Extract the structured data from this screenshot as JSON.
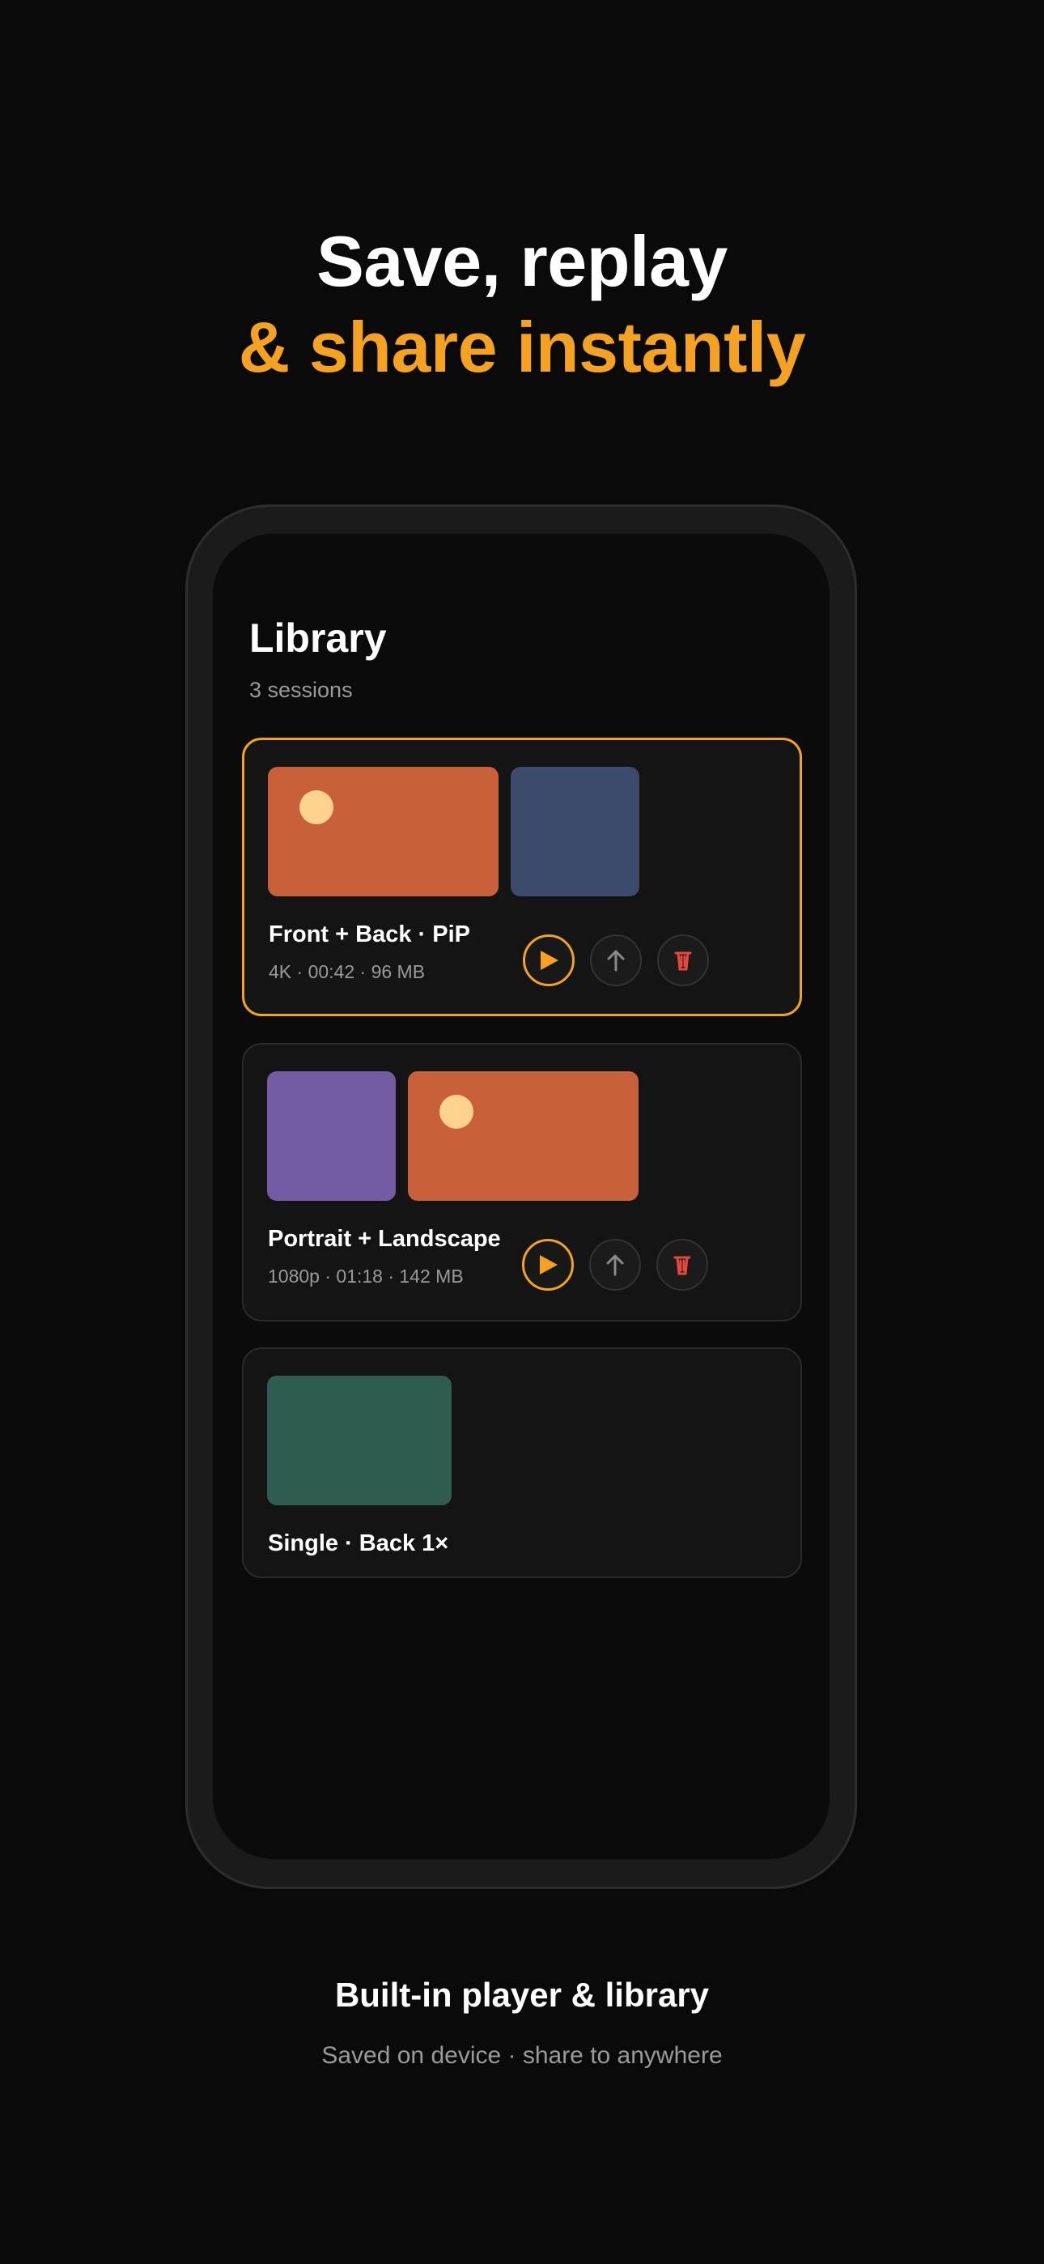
{
  "headline": {
    "line1": "Save, replay",
    "line2": "& share instantly"
  },
  "library": {
    "title": "Library",
    "subtitle": "3 sessions",
    "sessions": [
      {
        "title": "Front + Back · PiP",
        "meta": "4K · 00:42 · 96 MB",
        "selected": true,
        "thumbnails": [
          "#c8603a",
          "#3c4a6c"
        ],
        "actions": [
          "play-icon",
          "share-icon",
          "delete-icon"
        ]
      },
      {
        "title": "Portrait + Landscape",
        "meta": "1080p · 01:18 · 142 MB",
        "selected": false,
        "thumbnails": [
          "#735ca3",
          "#c8603a"
        ],
        "actions": [
          "play-icon",
          "share-icon",
          "delete-icon"
        ]
      },
      {
        "title": "Single · Back 1×",
        "selected": false,
        "thumbnails": [
          "#2f5c51"
        ]
      }
    ]
  },
  "footer": {
    "title": "Built-in player & library",
    "subtitle": "Saved on device · share to anywhere"
  },
  "colors": {
    "accent": "#f5a122",
    "background": "#0a0a0a",
    "delete": "#e5483c"
  }
}
